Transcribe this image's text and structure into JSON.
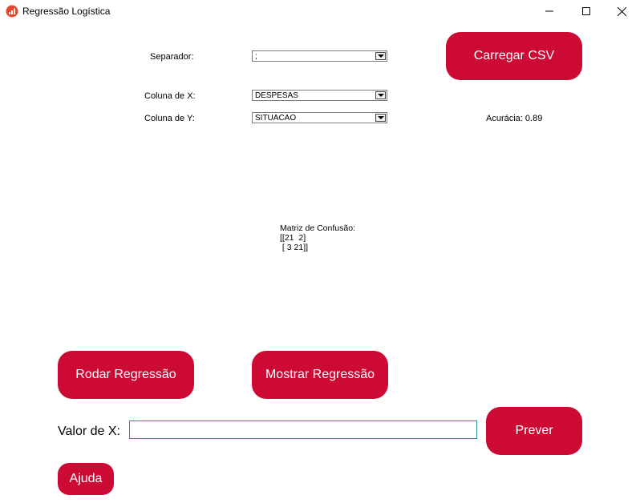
{
  "window": {
    "title": "Regressão Logística"
  },
  "controls": {
    "separator_label": "Separador:",
    "separator_value": ";",
    "x_column_label": "Coluna de X:",
    "x_column_value": "DESPESAS",
    "y_column_label": "Coluna de Y:",
    "y_column_value": "SITUACAO"
  },
  "buttons": {
    "load_csv": "Carregar CSV",
    "run_regression": "Rodar Regressão",
    "show_regression": "Mostrar Regressão",
    "predict": "Prever",
    "help": "Ajuda"
  },
  "results": {
    "accuracy": "Acurácia: 0.89",
    "confusion_title": "Matriz de Confusão:",
    "confusion_row1": "[[21  2]",
    "confusion_row2": " [ 3 21]]"
  },
  "prediction": {
    "x_label": "Valor de X:",
    "x_value": ""
  },
  "colors": {
    "accent": "#cc0a33",
    "input_border": "#2a8fa0"
  },
  "icons": [
    "app-chart-icon",
    "minimize-icon",
    "maximize-icon",
    "close-icon"
  ]
}
